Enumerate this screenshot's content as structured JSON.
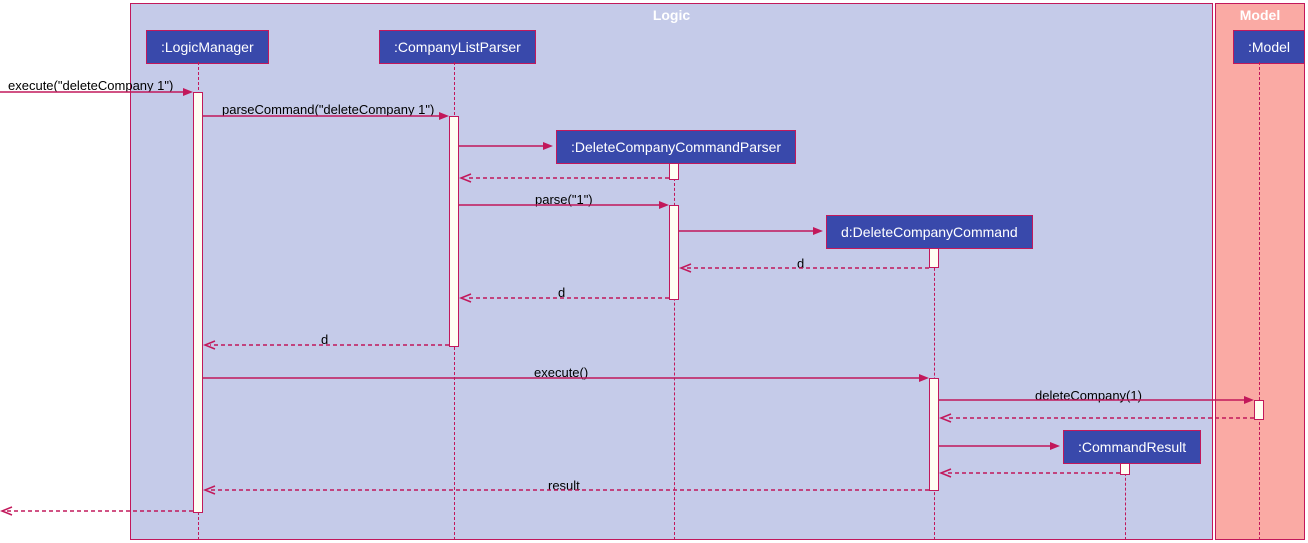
{
  "containers": {
    "logic": "Logic",
    "model": "Model"
  },
  "participants": {
    "logicManager": ":LogicManager",
    "companyListParser": ":CompanyListParser",
    "deleteCompanyCommandParser": ":DeleteCompanyCommandParser",
    "deleteCompanyCommand": "d:DeleteCompanyCommand",
    "commandResult": ":CommandResult",
    "modelObj": ":Model"
  },
  "messages": {
    "executeIn": "execute(\"deleteCompany 1\")",
    "parseCommand": "parseCommand(\"deleteCompany 1\")",
    "parse": "parse(\"1\")",
    "dReturn1": "d",
    "dReturn2": "d",
    "dReturn3": "d",
    "execute": "execute()",
    "deleteCompany": "deleteCompany(1)",
    "result": "result"
  }
}
